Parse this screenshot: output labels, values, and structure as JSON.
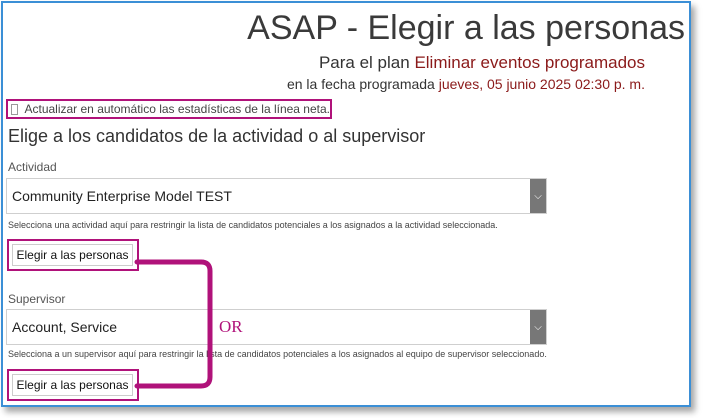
{
  "header": {
    "title": "ASAP - Elegir a las personas",
    "plan_prefix": "Para el plan",
    "plan_name": "Eliminar eventos programados",
    "date_prefix": "en la fecha programada",
    "date_value": "jueves, 05 junio 2025 02:30 p. m."
  },
  "auto_update": {
    "label": "Actualizar en automático las estadísticas de la línea neta.",
    "checked": false
  },
  "section_title": "Elige a los candidatos de la actividad o al supervisor",
  "activity": {
    "label": "Actividad",
    "selected": "Community Enterprise Model TEST",
    "help": "Selecciona una actividad aquí para restringir la lista de candidatos potenciales a los asignados a la actividad seleccionada.",
    "button": "Elegir a las personas"
  },
  "supervisor": {
    "label": "Supervisor",
    "selected": "Account, Service",
    "help": "Selecciona a un supervisor aquí para restringir la lista de candidatos potenciales a los asignados al equipo de supervisor seleccionado.",
    "button": "Elegir a las personas"
  },
  "annotation": {
    "or_text": "OR",
    "color": "#b0127a"
  },
  "colors": {
    "frame": "#3b8fd6",
    "accent_value": "#8b1a1a",
    "annotation": "#b0127a"
  }
}
